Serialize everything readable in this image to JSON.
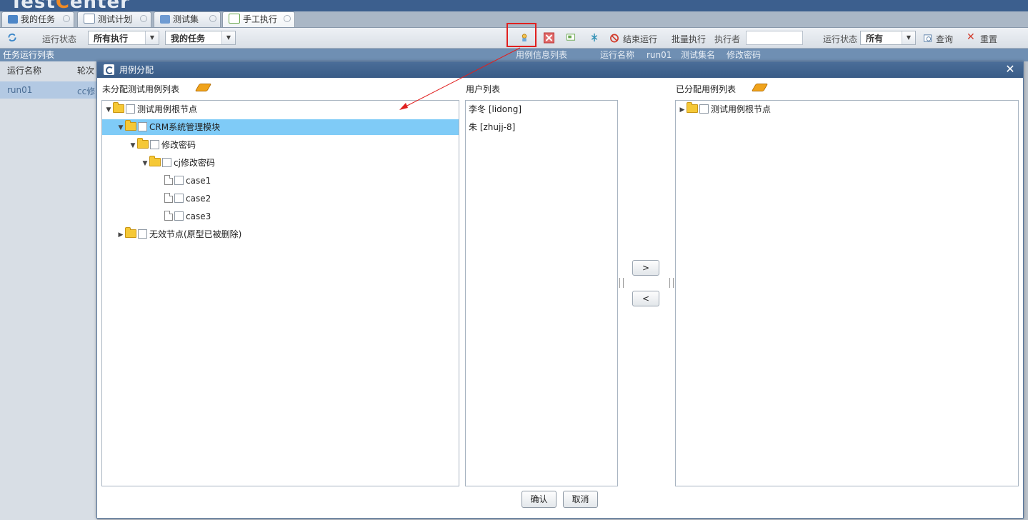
{
  "app": {
    "logo_pre": "Test",
    "logo_o": "C",
    "logo_post": "enter",
    "tabs": [
      {
        "label": "我的任务"
      },
      {
        "label": "测试计划"
      },
      {
        "label": "测试集"
      },
      {
        "label": "手工执行"
      }
    ]
  },
  "toolbar": {
    "run_status_label": "运行状态",
    "run_status_value": "所有执行",
    "task_value": "我的任务",
    "end_run": "结束运行",
    "batch_exec": "批量执行",
    "executor_label": "执行者",
    "executor_value": "",
    "status_label2": "运行状态",
    "status_value2": "所有",
    "query": "查询",
    "reset": "重置"
  },
  "left_list": {
    "title": "任务运行列表",
    "col_run_name": "运行名称",
    "col_round": "轮次",
    "row_run_name": "run01",
    "row_round": "cc修"
  },
  "right_strip": {
    "title": "用例信息列表",
    "run_name_label": "运行名称",
    "run_name_value": "run01",
    "set_label": "测试集名",
    "set_value": "修改密码"
  },
  "dialog": {
    "title": "用例分配",
    "unassigned_label": "未分配测试用例列表",
    "users_label": "用户列表",
    "assigned_label": "已分配用例列表",
    "left_tree": [
      {
        "label": "测试用例根节点"
      },
      {
        "label": "CRM系统管理模块"
      },
      {
        "label": "修改密码"
      },
      {
        "label": "cj修改密码"
      },
      {
        "label": "case1"
      },
      {
        "label": "case2"
      },
      {
        "label": "case3"
      },
      {
        "label": "无效节点(原型已被删除)"
      }
    ],
    "users": [
      {
        "label": "李冬 [lidong]"
      },
      {
        "label": "朱 [zhujj-8]"
      }
    ],
    "right_tree": [
      {
        "label": "测试用例根节点"
      }
    ],
    "move_right": ">",
    "move_left": "<",
    "confirm": "确认",
    "cancel": "取消"
  },
  "colors": {
    "selected_row": "#7fcbf7",
    "title_bar": "#3a5c87",
    "highlight": "#e0201f"
  }
}
